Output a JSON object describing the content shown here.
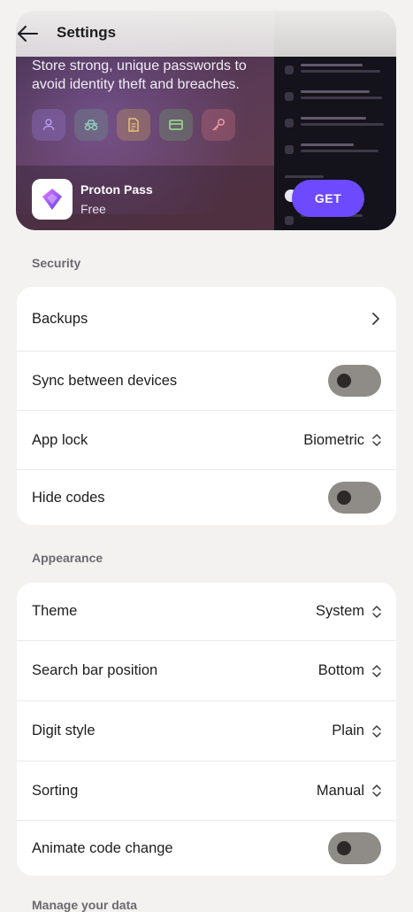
{
  "header": {
    "title": "Settings"
  },
  "promo": {
    "text": "Store strong, unique passwords to avoid identity theft and breaches.",
    "feature_icons": [
      "user-icon",
      "incognito-icon",
      "note-icon",
      "card-icon",
      "key-icon"
    ],
    "app_name": "Proton Pass",
    "app_price": "Free",
    "get_label": "GET"
  },
  "security": {
    "label": "Security",
    "backups": "Backups",
    "sync": {
      "label": "Sync between devices",
      "on": false
    },
    "app_lock": {
      "label": "App lock",
      "value": "Biometric"
    },
    "hide_codes": {
      "label": "Hide codes",
      "on": false
    }
  },
  "appearance": {
    "label": "Appearance",
    "theme": {
      "label": "Theme",
      "value": "System"
    },
    "search_bar": {
      "label": "Search bar position",
      "value": "Bottom"
    },
    "digit_style": {
      "label": "Digit style",
      "value": "Plain"
    },
    "sorting": {
      "label": "Sorting",
      "value": "Manual"
    },
    "animate": {
      "label": "Animate code change",
      "on": false
    }
  },
  "manage": {
    "label": "Manage your data"
  },
  "colors": {
    "accent": "#6d4aff",
    "toggle_track": "#8f8b87",
    "background": "#f3f2f0"
  }
}
